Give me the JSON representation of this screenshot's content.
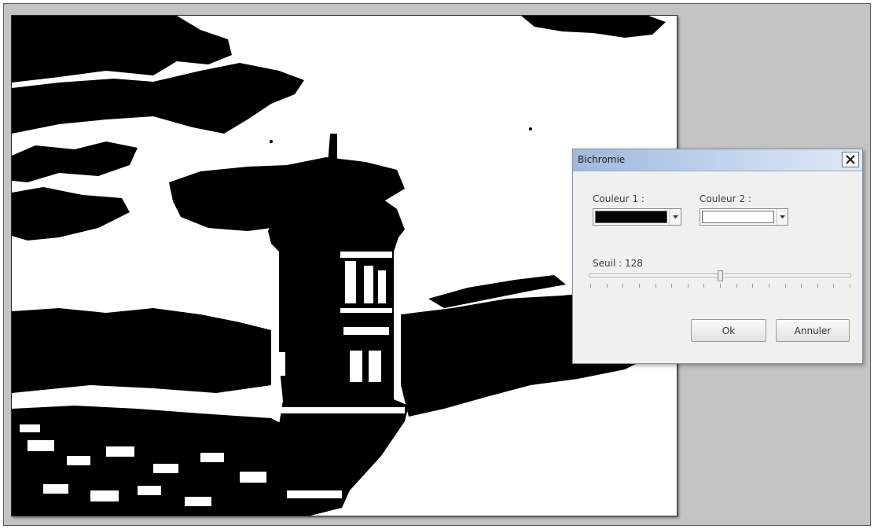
{
  "canvas": {
    "image": "binarized black-and-white photo of a stone watchtower (guérite) on a fortress wall under a cloudy sky",
    "colors": {
      "dark": "#000000",
      "light": "#ffffff"
    }
  },
  "dialog": {
    "title": "Bichromie",
    "close_icon": "close-icon",
    "color1": {
      "label": "Couleur 1 :",
      "value": "#000000"
    },
    "color2": {
      "label": "Couleur 2 :",
      "value": "#ffffff"
    },
    "threshold": {
      "label": "Seuil : 128",
      "value": 128,
      "min": 0,
      "max": 255,
      "tick_count": 16
    },
    "buttons": {
      "ok": "Ok",
      "cancel": "Annuler"
    }
  },
  "colors": {
    "workspace_bg": "#c4c4c4",
    "dialog_bg": "#f0f0f0",
    "titlebar": "#b3c9e6"
  }
}
